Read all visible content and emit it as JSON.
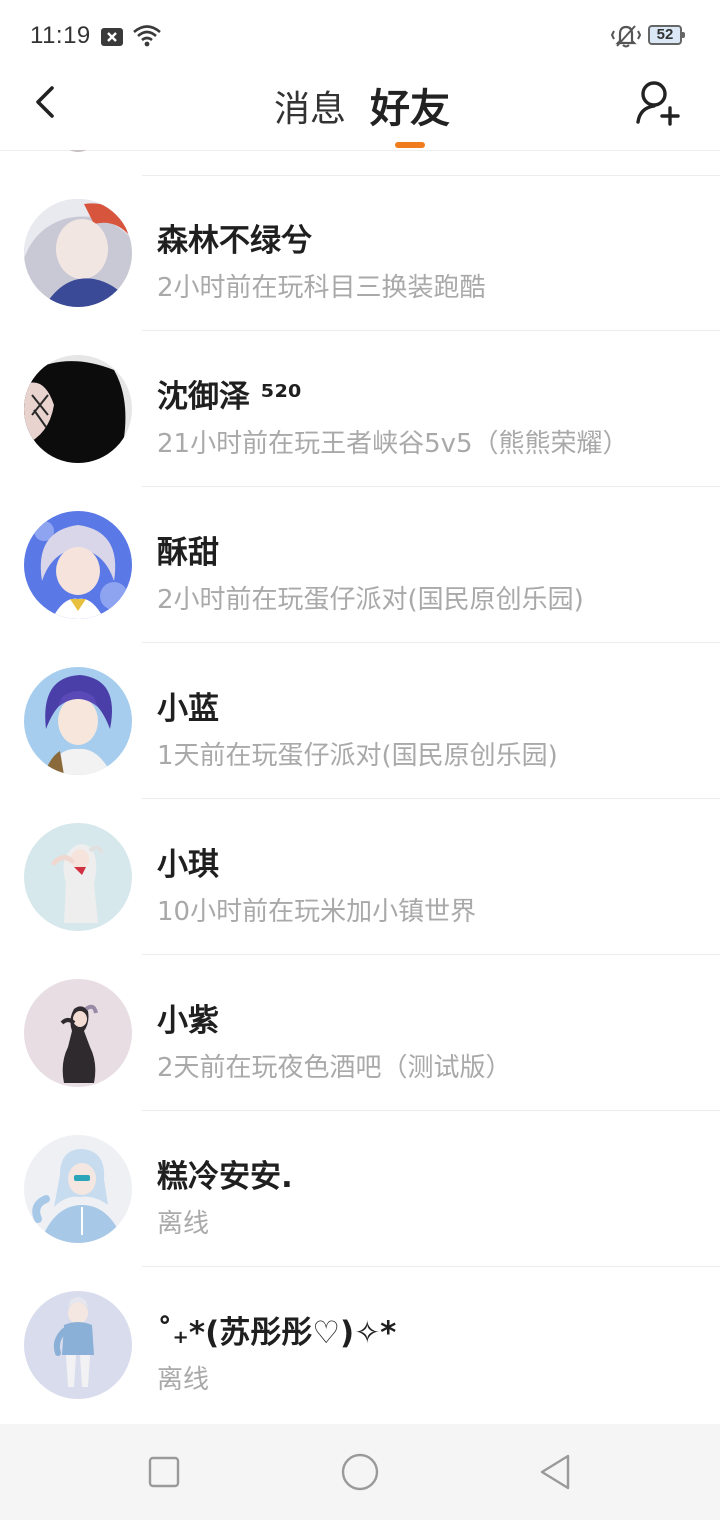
{
  "status_bar": {
    "time": "11:19",
    "battery": "52",
    "icons": [
      "notification-x-icon",
      "wifi-icon",
      "vibrate-icon",
      "battery-icon"
    ]
  },
  "header": {
    "tabs": [
      {
        "label": "消息",
        "active": false
      },
      {
        "label": "好友",
        "active": true
      }
    ],
    "accent_color": "#f07c1e",
    "icons": [
      "back-arrow-icon",
      "add-friend-icon"
    ]
  },
  "friends": [
    {
      "name": "森林不绿兮",
      "status": "2小时前在玩科目三换装跑酷",
      "avatar_color": "#7a86b8"
    },
    {
      "name": "沈御泽 ⁵²⁰",
      "status": "21小时前在玩王者峡谷5v5（熊熊荣耀）",
      "avatar_color": "#101010"
    },
    {
      "name": "酥甜",
      "status": "2小时前在玩蛋仔派对(国民原创乐园)",
      "avatar_color": "#6f86e0"
    },
    {
      "name": "小蓝",
      "status": "1天前在玩蛋仔派对(国民原创乐园)",
      "avatar_color": "#9cc6ec"
    },
    {
      "name": "小琪",
      "status": "10小时前在玩米加小镇世界",
      "avatar_color": "#d4e6ea"
    },
    {
      "name": "小紫",
      "status": "2天前在玩夜色酒吧（测试版）",
      "avatar_color": "#e9dfe4"
    },
    {
      "name": "糕冷安安.",
      "status": "离线",
      "avatar_color": "#c9ddf0"
    },
    {
      "name": "˚₊*(苏彤彤♡)✧*",
      "status": "离线",
      "avatar_color": "#d9dff0"
    }
  ],
  "navbar": {
    "icons": [
      "recents-square-icon",
      "home-circle-icon",
      "back-triangle-icon"
    ]
  }
}
